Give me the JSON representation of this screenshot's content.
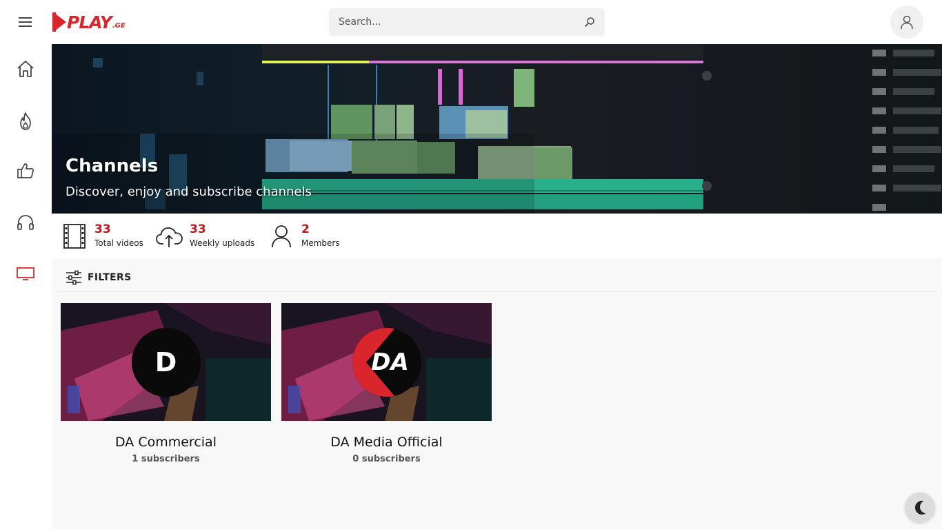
{
  "header": {
    "logo_text": "PLAY",
    "logo_suffix": ".GE",
    "search_placeholder": "Search..."
  },
  "sidebar": {
    "items": [
      {
        "name": "home",
        "icon": "home-icon",
        "active": false
      },
      {
        "name": "trending",
        "icon": "fire-icon",
        "active": false
      },
      {
        "name": "liked",
        "icon": "thumbs-up-icon",
        "active": false
      },
      {
        "name": "music",
        "icon": "headphones-icon",
        "active": false
      },
      {
        "name": "channels",
        "icon": "tv-icon",
        "active": true
      }
    ],
    "active_color": "#d8262c"
  },
  "hero": {
    "title": "Channels",
    "subtitle": "Discover, enjoy and subscribe channels"
  },
  "stats": [
    {
      "icon": "film-icon",
      "value": "33",
      "label": "Total videos"
    },
    {
      "icon": "cloud-upload-icon",
      "value": "33",
      "label": "Weekly uploads"
    },
    {
      "icon": "user-icon",
      "value": "2",
      "label": "Members"
    }
  ],
  "filters": {
    "label": "FILTERS"
  },
  "channels": [
    {
      "logo_text": "D",
      "name": "DA Commercial",
      "subscribers": "1 subscribers"
    },
    {
      "logo_text": "DA",
      "name": "DA Media Official",
      "subscribers": "0 subscribers"
    }
  ],
  "colors": {
    "brand": "#d8262c",
    "stat_number": "#b71c1c"
  }
}
